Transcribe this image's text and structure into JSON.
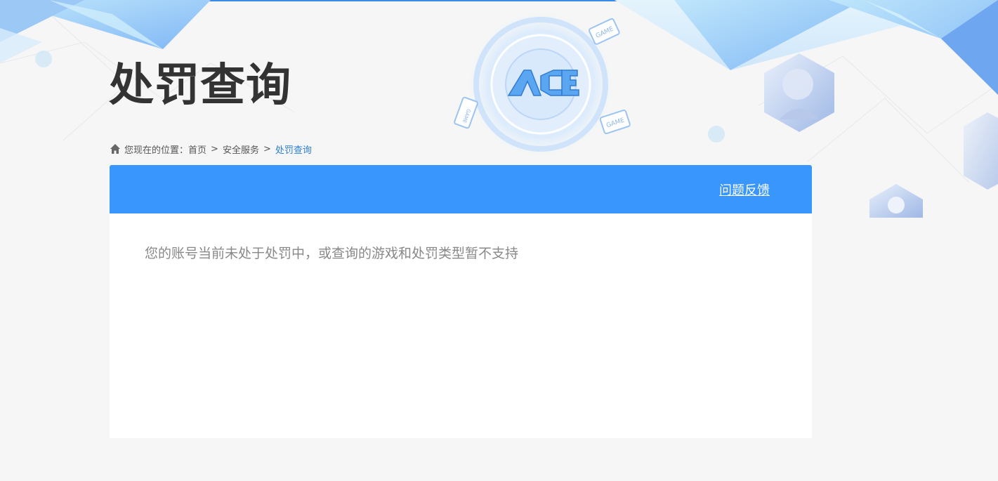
{
  "page": {
    "title": "处罚查询"
  },
  "breadcrumb": {
    "icon": "home-icon",
    "prefix": "您现在的位置：",
    "items": [
      "首页",
      "安全服务",
      "处罚查询"
    ],
    "separator": ">"
  },
  "card": {
    "feedback_label": "问题反馈",
    "message": "您的账号当前未处于处罚中，或查询的游戏和处罚类型暂不支持"
  },
  "logo": {
    "text": "ACE",
    "badge_text": "GAME"
  },
  "colors": {
    "accent": "#3896fd",
    "title": "#333333",
    "breadcrumb_current": "#2a7fd4",
    "message": "#888888",
    "background": "#f6f6f6"
  }
}
